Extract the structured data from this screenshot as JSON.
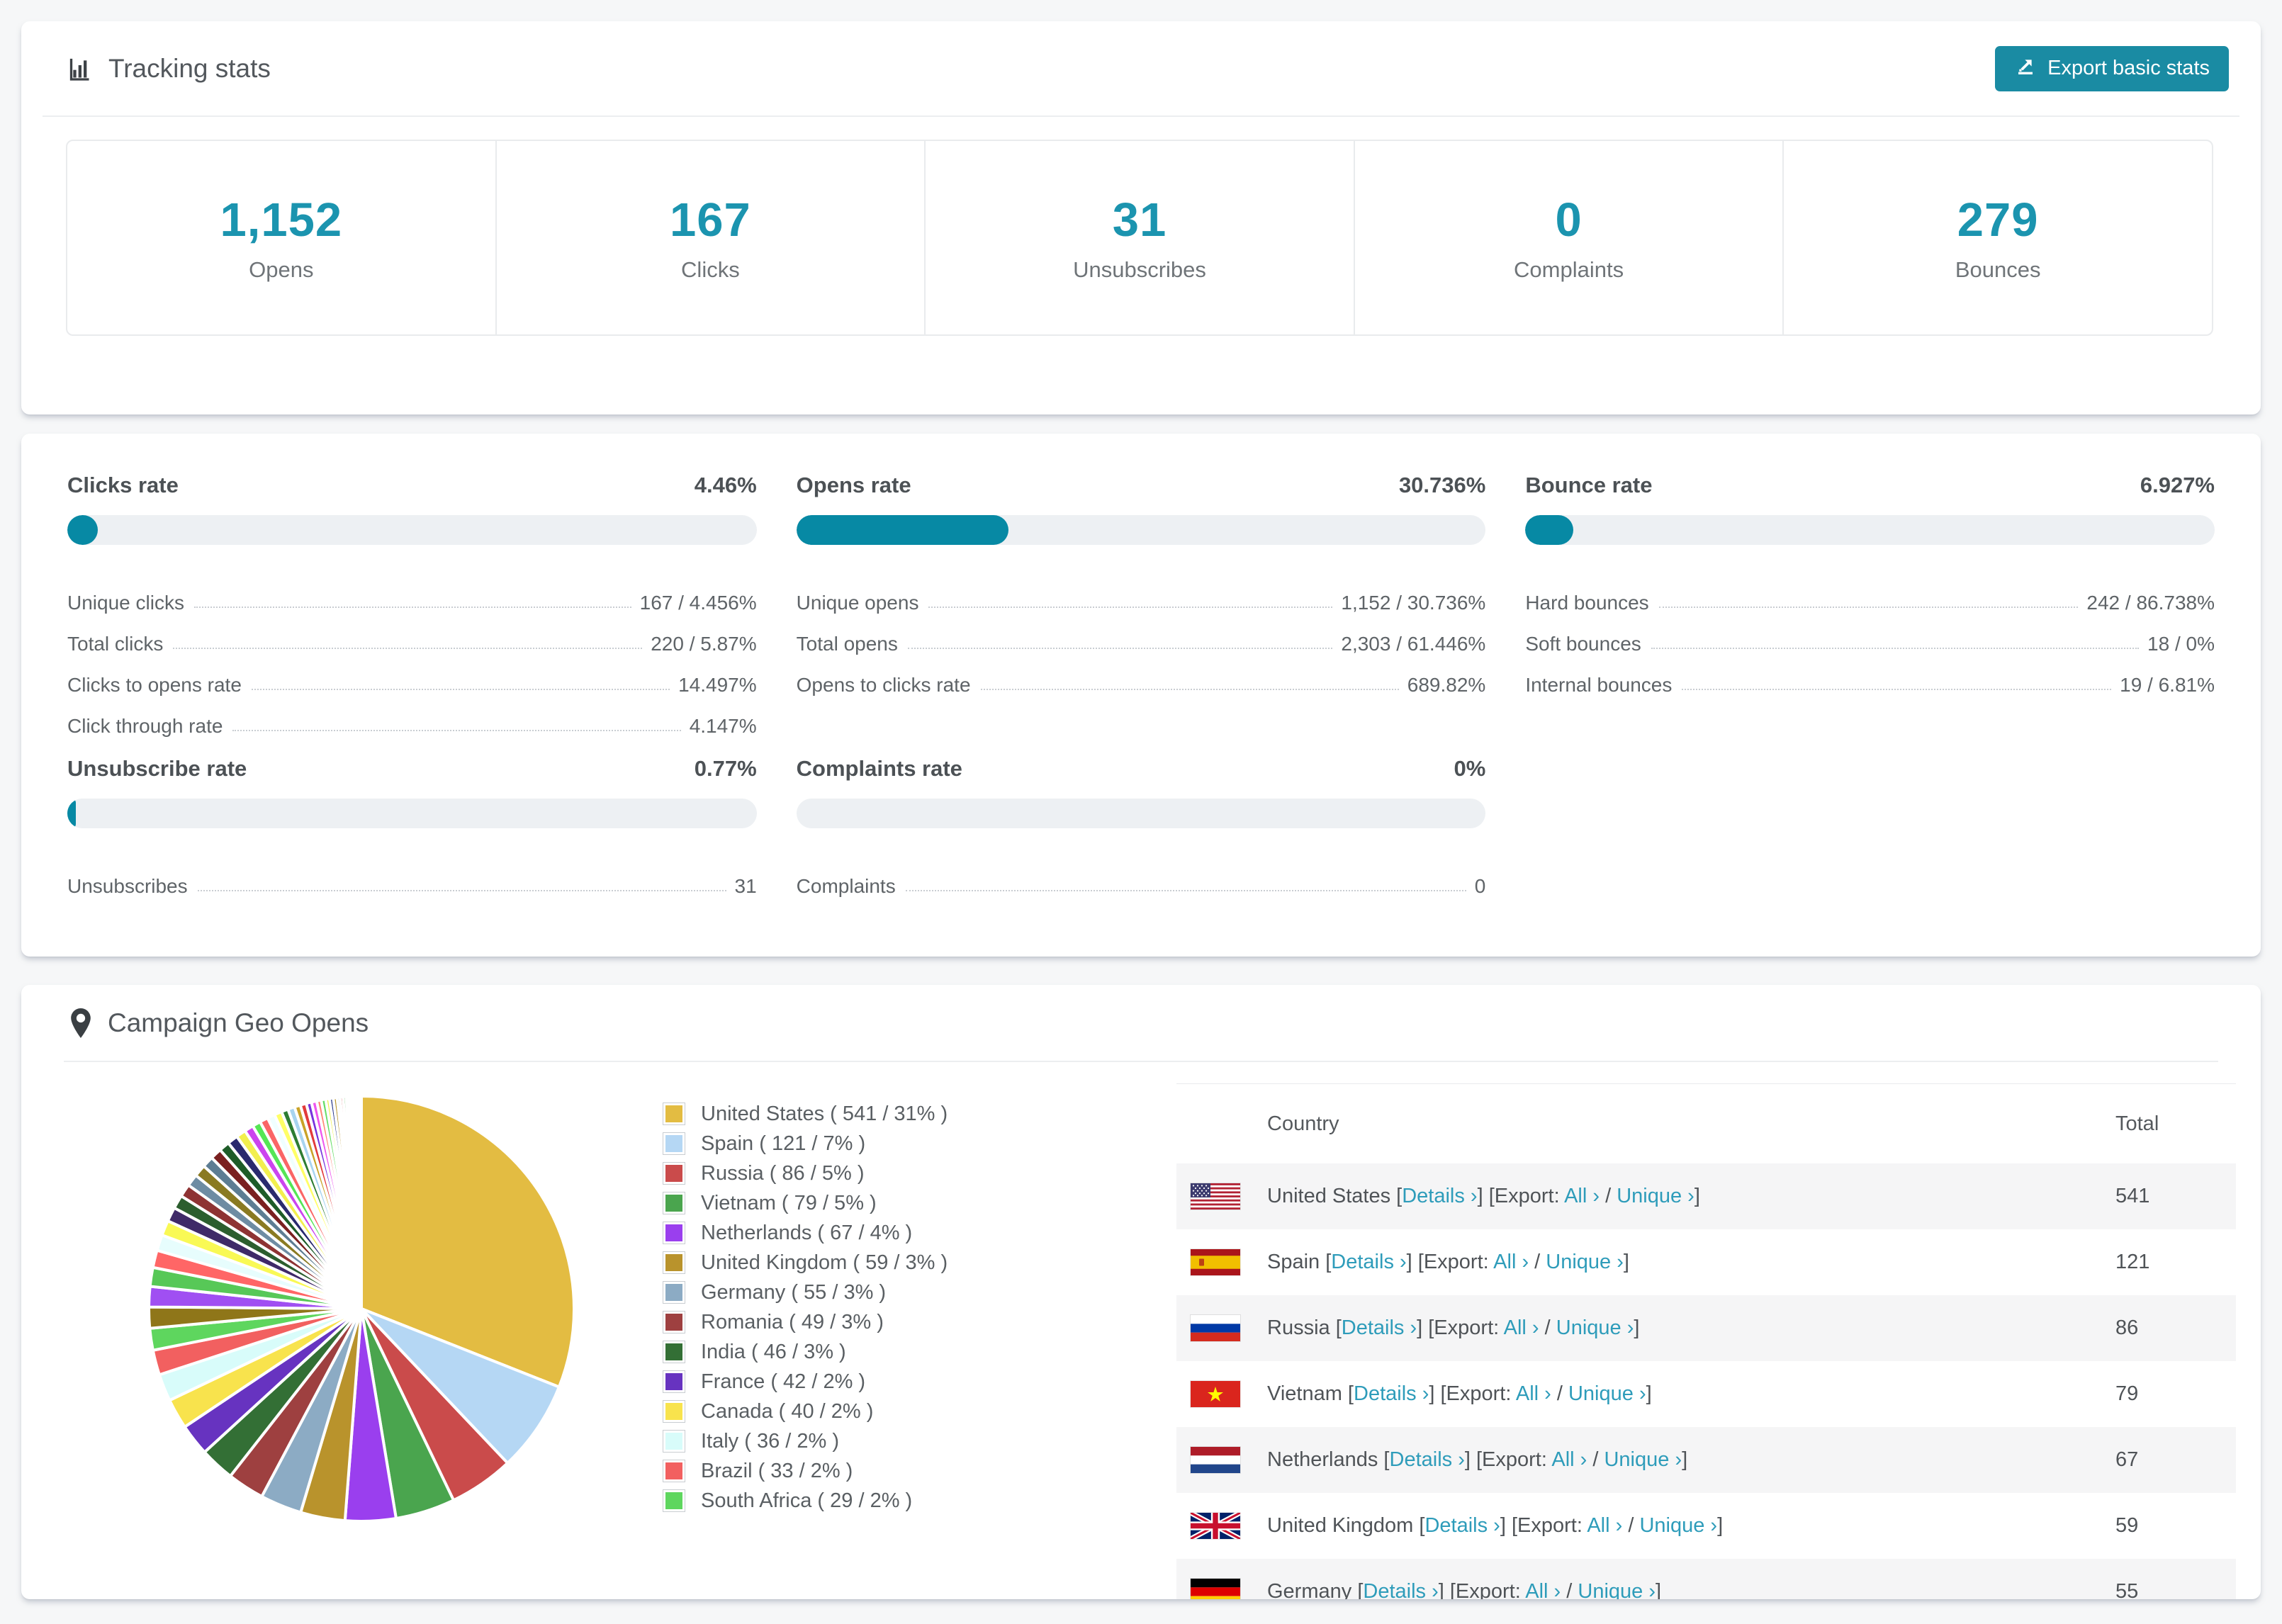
{
  "tracking": {
    "title": "Tracking stats",
    "export_label": "Export basic stats",
    "stats": [
      {
        "value": "1,152",
        "label": "Opens"
      },
      {
        "value": "167",
        "label": "Clicks"
      },
      {
        "value": "31",
        "label": "Unsubscribes"
      },
      {
        "value": "0",
        "label": "Complaints"
      },
      {
        "value": "279",
        "label": "Bounces"
      }
    ]
  },
  "rates": {
    "blocks": [
      {
        "label": "Clicks rate",
        "value": "4.46%",
        "bar_pct": 4.46,
        "rows": [
          [
            "Unique clicks",
            "167 / 4.456%"
          ],
          [
            "Total clicks",
            "220 / 5.87%"
          ],
          [
            "Clicks to opens rate",
            "14.497%"
          ],
          [
            "Click through rate",
            "4.147%"
          ]
        ]
      },
      {
        "label": "Opens rate",
        "value": "30.736%",
        "bar_pct": 30.736,
        "rows": [
          [
            "Unique opens",
            "1,152 / 30.736%"
          ],
          [
            "Total opens",
            "2,303 / 61.446%"
          ],
          [
            "Opens to clicks rate",
            "689.82%"
          ]
        ]
      },
      {
        "label": "Bounce rate",
        "value": "6.927%",
        "bar_pct": 6.927,
        "rows": [
          [
            "Hard bounces",
            "242 / 86.738%"
          ],
          [
            "Soft bounces",
            "18 / 0%"
          ],
          [
            "Internal bounces",
            "19 / 6.81%"
          ]
        ]
      },
      {
        "label": "Unsubscribe rate",
        "value": "0.77%",
        "bar_pct": 0.77,
        "rows": [
          [
            "Unsubscribes",
            "31"
          ]
        ]
      },
      {
        "label": "Complaints rate",
        "value": "0%",
        "bar_pct": 0,
        "rows": [
          [
            "Complaints",
            "0"
          ]
        ]
      }
    ]
  },
  "geo": {
    "title": "Campaign Geo Opens",
    "table": {
      "headers": [
        "Country",
        "Total"
      ],
      "details_link": "Details ›",
      "export_prefix": "Export:",
      "all_link": "All ›",
      "unique_link": "Unique ›",
      "rows": [
        {
          "country": "United States",
          "flag": "us",
          "total": "541"
        },
        {
          "country": "Spain",
          "flag": "es",
          "total": "121"
        },
        {
          "country": "Russia",
          "flag": "ru",
          "total": "86"
        },
        {
          "country": "Vietnam",
          "flag": "vn",
          "total": "79"
        },
        {
          "country": "Netherlands",
          "flag": "nl",
          "total": "67"
        },
        {
          "country": "United Kingdom",
          "flag": "gb",
          "total": "59"
        },
        {
          "country": "Germany",
          "flag": "de",
          "total": "55",
          "partial": true
        }
      ]
    }
  },
  "colors": {
    "accent_teal": "#1b94af",
    "button_teal": "#1a8ba3",
    "bar_teal": "#0789a4",
    "link_teal": "#2e9cba",
    "zebra_row": "#f5f5f6"
  },
  "chart_data": {
    "type": "pie",
    "title": "Campaign Geo Opens",
    "start_angle_deg": -90,
    "direction": "clockwise",
    "legend_position": "right",
    "series": [
      {
        "label": "United States",
        "value": 541,
        "pct": "31%",
        "color": "#e3bc42"
      },
      {
        "label": "Spain",
        "value": 121,
        "pct": "7%",
        "color": "#b5d7f4"
      },
      {
        "label": "Russia",
        "value": 86,
        "pct": "5%",
        "color": "#ca4b4b"
      },
      {
        "label": "Vietnam",
        "value": 79,
        "pct": "5%",
        "color": "#4aa54e"
      },
      {
        "label": "Netherlands",
        "value": 67,
        "pct": "4%",
        "color": "#9a3fee"
      },
      {
        "label": "United Kingdom",
        "value": 59,
        "pct": "3%",
        "color": "#b9932c"
      },
      {
        "label": "Germany",
        "value": 55,
        "pct": "3%",
        "color": "#8cabc4"
      },
      {
        "label": "Romania",
        "value": 49,
        "pct": "3%",
        "color": "#9e4040"
      },
      {
        "label": "India",
        "value": 46,
        "pct": "3%",
        "color": "#336f35"
      },
      {
        "label": "France",
        "value": 42,
        "pct": "2%",
        "color": "#6733c0"
      },
      {
        "label": "Canada",
        "value": 40,
        "pct": "2%",
        "color": "#f8e34d"
      },
      {
        "label": "Italy",
        "value": 36,
        "pct": "2%",
        "color": "#d8fcfa"
      },
      {
        "label": "Brazil",
        "value": 33,
        "pct": "2%",
        "color": "#f26060"
      },
      {
        "label": "South Africa",
        "value": 29,
        "pct": "2%",
        "color": "#5ed65e"
      }
    ],
    "others_tail": {
      "values": [
        28,
        27,
        25,
        23,
        21,
        20,
        19,
        18,
        17,
        16,
        16,
        15,
        15,
        14,
        14,
        13,
        12,
        11,
        11,
        10,
        10,
        9,
        9,
        8,
        8,
        7,
        7,
        6,
        6,
        5,
        5,
        5,
        4,
        4,
        4,
        3,
        3,
        3,
        2,
        2,
        2,
        2,
        1,
        1,
        1
      ],
      "colors": [
        "#8f7619",
        "#a04ff2",
        "#57c857",
        "#ff6666",
        "#e7fdfd",
        "#f9f955",
        "#3f2a68",
        "#2c5e2e",
        "#8e3333",
        "#6e8ca3",
        "#8a7a22",
        "#5d7d93",
        "#7a2020",
        "#1e5c28",
        "#2a2a6e",
        "#f2ef4e",
        "#cc44ee",
        "#55e655",
        "#fa6666",
        "#f0ffff",
        "#ffff66",
        "#2e7d32",
        "#a8d4f0",
        "#c9a227",
        "#e23b3b",
        "#7733dd",
        "#ee55ee",
        "#ff8877",
        "#66dd66",
        "#eeee44",
        "#223388",
        "#b8962e",
        "#99ccee",
        "#cc3333",
        "#33aa33",
        "#8844ff"
      ]
    }
  }
}
